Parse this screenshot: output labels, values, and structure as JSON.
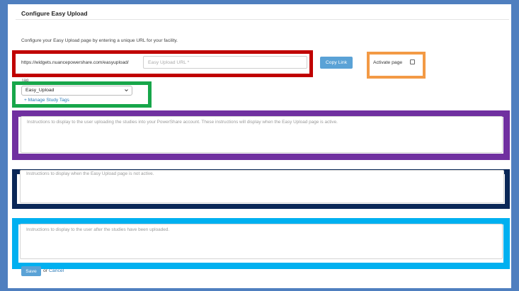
{
  "panel": {
    "title": "Configure Easy Upload",
    "intro": "Configure your Easy Upload page by entering a unique URL for your facility."
  },
  "url": {
    "prefix": "https://widgets.nuancepowershare.com/easyupload/",
    "placeholder": "Easy Upload URL *",
    "copy_label": "Copy Link"
  },
  "activate": {
    "label": "Activate page",
    "checked": false
  },
  "tag": {
    "label": "Tag",
    "selected": "Easy_Upload",
    "manage_link": "+ Manage Study Tags"
  },
  "instructions": {
    "active_placeholder": "Instructions to display to the user uploading the studies into your PowerShare account. These instructions will display when the Easy Upload page is active.",
    "inactive_placeholder": "Instructions to display when the Easy Upload page is not active.",
    "uploaded_placeholder": "Instructions to display to the user after the studies have been uploaded."
  },
  "actions": {
    "save_label": "Save",
    "or_text": "or",
    "cancel_label": "Cancel"
  },
  "colors": {
    "frame": "#4f7fbf",
    "accent_button": "#5aa2d6",
    "link": "#2a7ab8",
    "highlight_red": "#c00000",
    "highlight_orange": "#f39a45",
    "highlight_green": "#17a64a",
    "highlight_purple": "#7030a0",
    "highlight_navy": "#0a2757",
    "highlight_cyan": "#00b0f0"
  },
  "icons": {
    "select_arrow": "chevron-down-icon"
  }
}
